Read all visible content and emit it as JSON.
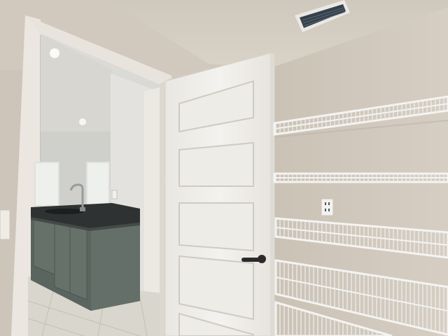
{
  "scene": {
    "subject": "pantry-closet-with-open-door",
    "palette": {
      "wall": "#d3cbc0",
      "wall_shadow": "#c4bbaf",
      "ceiling": "#d8d1c6",
      "trim": "#ece8e1",
      "door": "#f1efea",
      "door_shadow": "#d9d6cf",
      "cabinet": "#5f6a64",
      "countertop": "#2f3333",
      "floor": "#d8d4cb",
      "shelf_wire": "#f4f4f2",
      "vent": "#3a4752",
      "handle": "#2a2a2a"
    },
    "icons": [
      "air-vent-icon",
      "power-outlet-icon",
      "light-switch-icon",
      "door-handle-icon",
      "faucet-icon"
    ]
  }
}
